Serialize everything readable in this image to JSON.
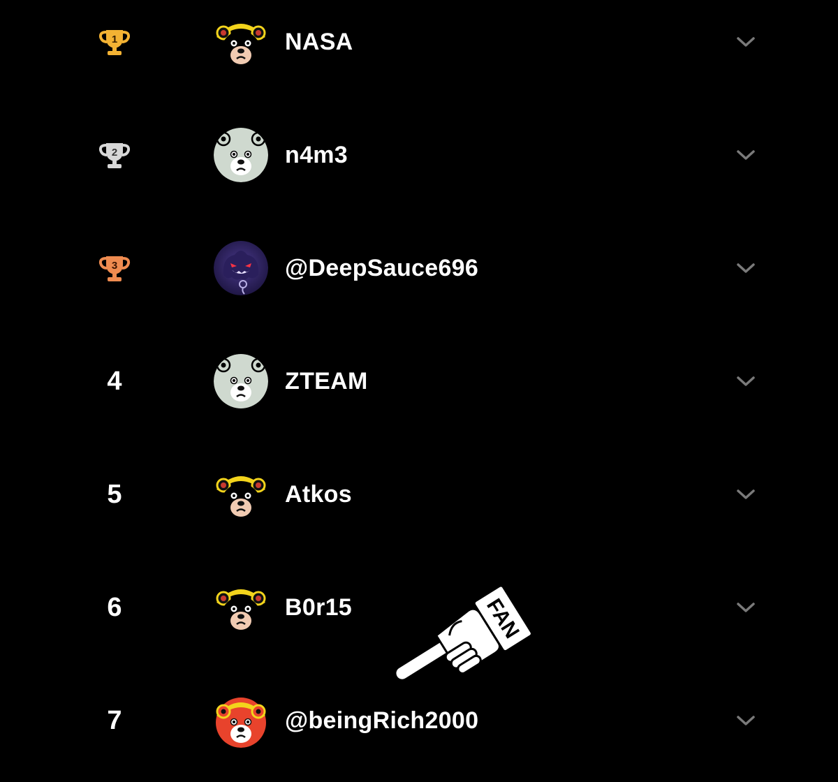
{
  "leaderboard": {
    "rows": [
      {
        "rank": "1",
        "rank_type": "gold-trophy",
        "avatar": "bear-black-yellow-hat",
        "username": "NASA"
      },
      {
        "rank": "2",
        "rank_type": "silver-trophy",
        "avatar": "bear-grey",
        "username": "n4m3"
      },
      {
        "rank": "3",
        "rank_type": "bronze-trophy",
        "avatar": "purple-ghost",
        "username": "@DeepSauce696"
      },
      {
        "rank": "4",
        "rank_type": "number",
        "avatar": "bear-grey",
        "username": "ZTEAM"
      },
      {
        "rank": "5",
        "rank_type": "number",
        "avatar": "bear-black-yellow-hat",
        "username": "Atkos"
      },
      {
        "rank": "6",
        "rank_type": "number",
        "avatar": "bear-black-yellow-hat",
        "username": "B0r15"
      },
      {
        "rank": "7",
        "rank_type": "number",
        "avatar": "bear-red-yellow-hat",
        "username": "@beingRich2000"
      }
    ],
    "expand_icon": "chevron-down-icon"
  },
  "sticker": {
    "text": "FAN",
    "icon": "pointing-hand-icon"
  },
  "colors": {
    "background": "#000000",
    "gold": "#f3b233",
    "silver": "#d7d7d7",
    "bronze": "#ef8b50",
    "chevron": "#7a7a7a",
    "text": "#ffffff"
  }
}
